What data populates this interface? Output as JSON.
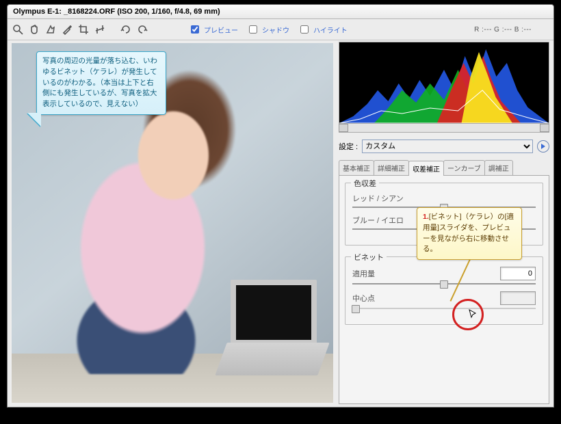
{
  "title": "Olympus E-1:  _8168224.ORF   (ISO 200, 1/160, f/4.8, 69 mm)",
  "toolbar": {
    "preview_label": "プレビュー",
    "shadow_label": "シャドウ",
    "highlight_label": "ハイライト",
    "preview_checked": true,
    "shadow_checked": false,
    "highlight_checked": false
  },
  "rgb_readout": "R :---   G :---   B :---",
  "settings": {
    "label": "設定 :",
    "value": "カスタム"
  },
  "tabs": {
    "items": [
      "基本補正",
      "詳細補正",
      "収差補正",
      "ーンカーブ",
      "調補正"
    ],
    "active": 2
  },
  "chromatic_group": {
    "legend": "色収差",
    "row1_label": "レッド / シアン",
    "row2_label": "ブルー / イエロ"
  },
  "vignette_group": {
    "legend": "ビネット",
    "amount_label": "適用量",
    "amount_value": "0",
    "midpoint_label": "中心点",
    "midpoint_value": ""
  },
  "callout_blue": "写真の周辺の光量が落ち込む、いわゆるビネット（ケラレ）が発生しているのがわかる。（本当は上下と右側にも発生しているが、写真を拡大表示しているので、見えない）",
  "callout_yellow": {
    "num": "1.",
    "text": "[ビネット]（ケラレ）の[適用量]スライダを、プレビューを見ながら右に移動させる。"
  }
}
